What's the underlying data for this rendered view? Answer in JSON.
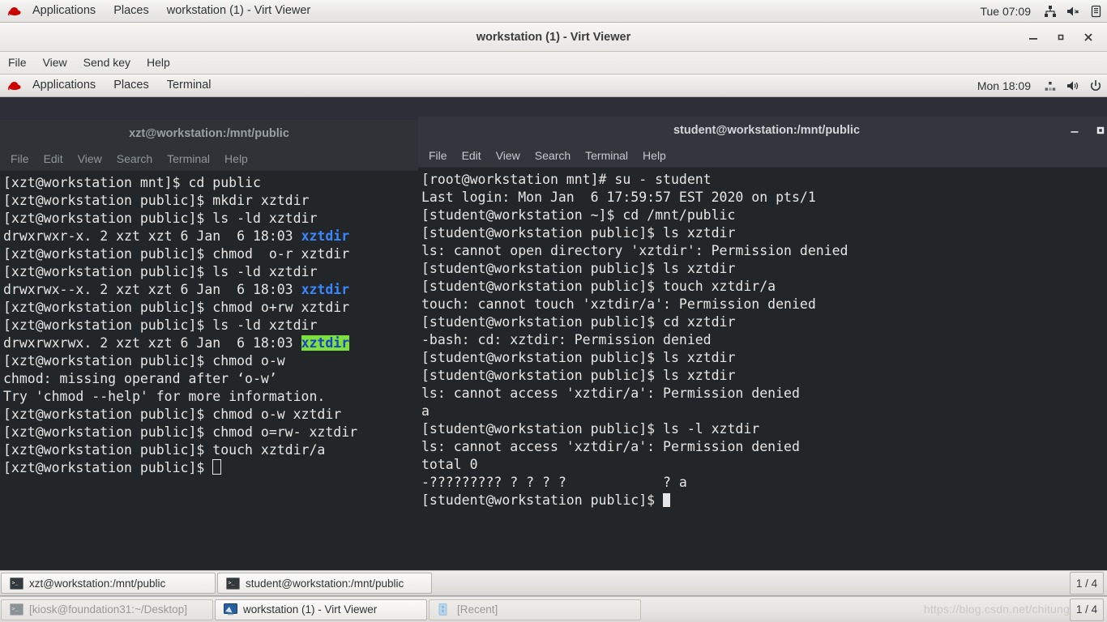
{
  "host_topbar": {
    "logo_icon": "redhat-logo-icon",
    "items": [
      {
        "label": "Applications"
      },
      {
        "label": "Places"
      },
      {
        "label": "workstation (1) - Virt Viewer"
      }
    ],
    "clock": "Tue 07:09",
    "tray": [
      "network-icon",
      "volume-muted-icon",
      "battery-icon"
    ]
  },
  "virt_viewer": {
    "title": "workstation (1) - Virt Viewer",
    "window_buttons": [
      "minimize-icon",
      "maximize-icon",
      "close-icon"
    ],
    "menu": [
      {
        "label": "File"
      },
      {
        "label": "View"
      },
      {
        "label": "Send key"
      },
      {
        "label": "Help"
      }
    ]
  },
  "guest_topbar": {
    "logo_icon": "redhat-logo-icon",
    "items": [
      {
        "label": "Applications"
      },
      {
        "label": "Places"
      },
      {
        "label": "Terminal"
      }
    ],
    "clock": "Mon 18:09",
    "tray": [
      "network-icon",
      "volume-icon",
      "power-icon"
    ]
  },
  "terminal_left": {
    "title": "xzt@workstation:/mnt/public",
    "menu": [
      {
        "label": "File"
      },
      {
        "label": "Edit"
      },
      {
        "label": "View"
      },
      {
        "label": "Search"
      },
      {
        "label": "Terminal"
      },
      {
        "label": "Help"
      }
    ],
    "lines": [
      [
        {
          "t": "[xzt@workstation mnt]$ cd public"
        }
      ],
      [
        {
          "t": "[xzt@workstation public]$ mkdir xztdir"
        }
      ],
      [
        {
          "t": "[xzt@workstation public]$ ls -ld xztdir"
        }
      ],
      [
        {
          "t": "drwxrwxr-x. 2 xzt xzt 6 Jan  6 18:03 "
        },
        {
          "t": "xztdir",
          "c": "dir"
        }
      ],
      [
        {
          "t": "[xzt@workstation public]$ chmod  o-r xztdir"
        }
      ],
      [
        {
          "t": "[xzt@workstation public]$ ls -ld xztdir"
        }
      ],
      [
        {
          "t": "drwxrwx--x. 2 xzt xzt 6 Jan  6 18:03 "
        },
        {
          "t": "xztdir",
          "c": "dir"
        }
      ],
      [
        {
          "t": "[xzt@workstation public]$ chmod o+rw xztdir"
        }
      ],
      [
        {
          "t": "[xzt@workstation public]$ ls -ld xztdir"
        }
      ],
      [
        {
          "t": "drwxrwxrwx. 2 xzt xzt 6 Jan  6 18:03 "
        },
        {
          "t": "xztdir",
          "c": "sel"
        }
      ],
      [
        {
          "t": "[xzt@workstation public]$ chmod o-w"
        }
      ],
      [
        {
          "t": "chmod: missing operand after ‘o-w’"
        }
      ],
      [
        {
          "t": "Try 'chmod --help' for more information."
        }
      ],
      [
        {
          "t": "[xzt@workstation public]$ chmod o-w xztdir"
        }
      ],
      [
        {
          "t": "[xzt@workstation public]$ chmod o=rw- xztdir"
        }
      ],
      [
        {
          "t": "[xzt@workstation public]$ touch xztdir/a"
        }
      ],
      [
        {
          "t": "[xzt@workstation public]$ "
        },
        {
          "t": " ",
          "c": "cursor-hollow"
        }
      ]
    ]
  },
  "terminal_right": {
    "title": "student@workstation:/mnt/public",
    "menu": [
      {
        "label": "File"
      },
      {
        "label": "Edit"
      },
      {
        "label": "View"
      },
      {
        "label": "Search"
      },
      {
        "label": "Terminal"
      },
      {
        "label": "Help"
      }
    ],
    "window_buttons": [
      "minimize-icon",
      "maximize-icon"
    ],
    "lines": [
      [
        {
          "t": "[root@workstation mnt]# su - student"
        }
      ],
      [
        {
          "t": "Last login: Mon Jan  6 17:59:57 EST 2020 on pts/1"
        }
      ],
      [
        {
          "t": "[student@workstation ~]$ cd /mnt/public"
        }
      ],
      [
        {
          "t": "[student@workstation public]$ ls xztdir"
        }
      ],
      [
        {
          "t": "ls: cannot open directory 'xztdir': Permission denied"
        }
      ],
      [
        {
          "t": "[student@workstation public]$ ls xztdir"
        }
      ],
      [
        {
          "t": "[student@workstation public]$ touch xztdir/a"
        }
      ],
      [
        {
          "t": "touch: cannot touch 'xztdir/a': Permission denied"
        }
      ],
      [
        {
          "t": "[student@workstation public]$ cd xztdir"
        }
      ],
      [
        {
          "t": "-bash: cd: xztdir: Permission denied"
        }
      ],
      [
        {
          "t": "[student@workstation public]$ ls xztdir"
        }
      ],
      [
        {
          "t": "[student@workstation public]$ ls xztdir"
        }
      ],
      [
        {
          "t": "ls: cannot access 'xztdir/a': Permission denied"
        }
      ],
      [
        {
          "t": "a"
        }
      ],
      [
        {
          "t": "[student@workstation public]$ ls -l xztdir"
        }
      ],
      [
        {
          "t": "ls: cannot access 'xztdir/a': Permission denied"
        }
      ],
      [
        {
          "t": "total 0"
        }
      ],
      [
        {
          "t": "-????????? ? ? ? ?            ? a"
        }
      ],
      [
        {
          "t": "[student@workstation public]$ "
        },
        {
          "t": " ",
          "c": "cursor-solid"
        }
      ]
    ]
  },
  "guest_taskbar": {
    "buttons": [
      {
        "label": "xzt@workstation:/mnt/public",
        "icon": "terminal-icon",
        "state": "active"
      },
      {
        "label": "student@workstation:/mnt/public",
        "icon": "terminal-icon",
        "state": "active"
      }
    ],
    "workspace": "1 / 4"
  },
  "host_taskbar": {
    "buttons": [
      {
        "label": "[kiosk@foundation31:~/Desktop]",
        "icon": "terminal-icon",
        "state": "dim"
      },
      {
        "label": "workstation (1) - Virt Viewer",
        "icon": "virt-viewer-icon",
        "state": "active"
      },
      {
        "label": "[Recent]",
        "icon": "files-icon",
        "state": "dim"
      }
    ],
    "workspace": "1 / 4"
  },
  "watermark": "https://blog.csdn.net/chitung",
  "colors": {
    "terminal_bg": "#232629",
    "terminal_fg": "#e6e6e6",
    "dir_blue": "#3a87fd",
    "selection_bg": "#7ee03c",
    "selection_fg": "#1b40c8",
    "active_accent": "#87b8cc",
    "desktop_bg": "#2c2f38"
  }
}
